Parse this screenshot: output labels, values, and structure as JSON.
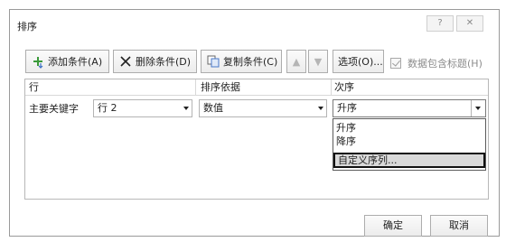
{
  "window": {
    "title": "排序",
    "help_glyph": "?",
    "close_glyph": "✕"
  },
  "toolbar": {
    "add_label": "添加条件(A)",
    "delete_label": "删除条件(D)",
    "copy_label": "复制条件(C)",
    "up_glyph": "▲",
    "down_glyph": "▼",
    "options_label": "选项(O)...",
    "header_checkbox_label": "数据包含标题(H)",
    "header_checkbox_checked": true
  },
  "grid": {
    "headers": {
      "column": "行",
      "sort_on": "排序依据",
      "order": "次序"
    },
    "row": {
      "label": "主要关键字",
      "key_value": "行 2",
      "sort_on_value": "数值",
      "order_value": "升序"
    }
  },
  "order_dropdown": {
    "items": [
      "升序",
      "降序",
      "自定义序列..."
    ],
    "highlighted_index": 2
  },
  "footer": {
    "ok_label": "确定",
    "cancel_label": "取消"
  },
  "icons": {
    "add": "add-condition-icon",
    "delete": "delete-condition-icon",
    "copy": "copy-condition-icon"
  },
  "colors": {
    "add_icon_green": "#3a9a3a",
    "delete_icon": "#222222",
    "copy_icon_blue": "#4a78c8"
  }
}
